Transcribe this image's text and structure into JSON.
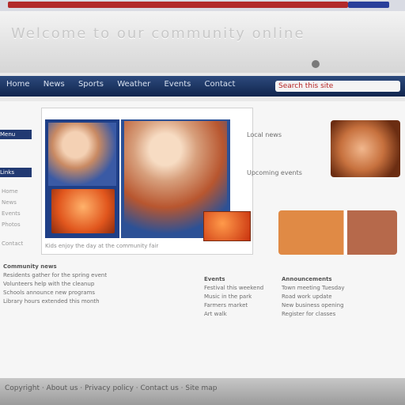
{
  "header": {
    "site_title": "Welcome to our community online"
  },
  "nav": {
    "links": [
      "Home",
      "News",
      "Sports",
      "Weather",
      "Events",
      "Contact"
    ],
    "search_placeholder": "Search this site"
  },
  "sidebar": {
    "tab_top": "Menu",
    "tab_mid": "Links",
    "lines": [
      "Home",
      "News",
      "Events",
      "Photos",
      "Contact"
    ]
  },
  "feature": {
    "caption": "Kids enjoy the day at the community fair"
  },
  "right_column": {
    "link_1": "Local news",
    "link_2": "Upcoming events"
  },
  "article": {
    "col1": {
      "heading": "Community news",
      "lines": [
        "Residents gather for the spring event",
        "Volunteers help with the cleanup",
        "Schools announce new programs",
        "Library hours extended this month"
      ]
    },
    "col2": {
      "heading": "Events",
      "lines": [
        "Festival this weekend",
        "Music in the park",
        "Farmers market",
        "Art walk"
      ]
    },
    "col3": {
      "heading": "Announcements",
      "lines": [
        "Town meeting Tuesday",
        "Road work update",
        "New business opening",
        "Register for classes"
      ]
    }
  },
  "footer": {
    "text": "Copyright · About us · Privacy policy · Contact us · Site map"
  }
}
